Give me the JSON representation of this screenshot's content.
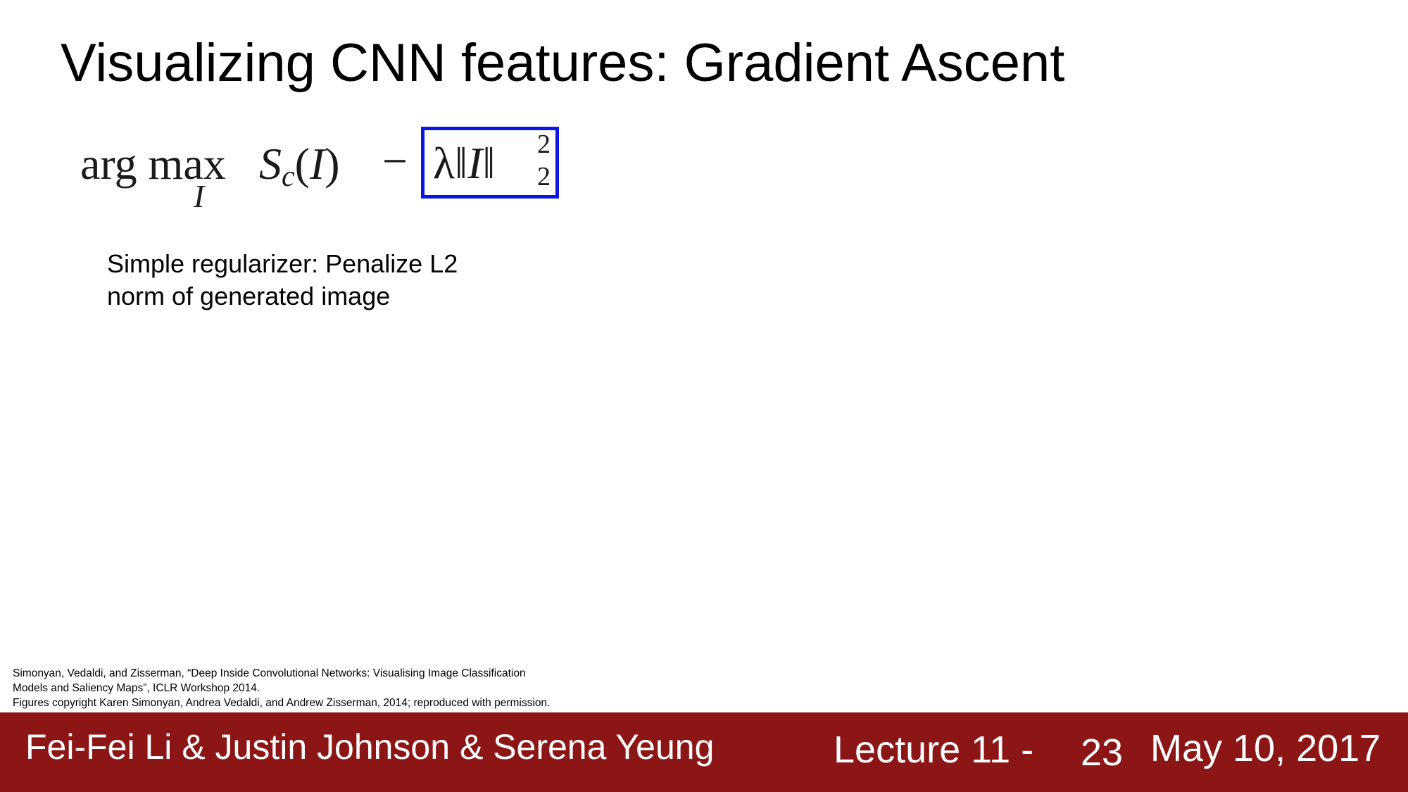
{
  "slide": {
    "title": "Visualizing CNN features: Gradient Ascent",
    "formula": {
      "operator": "arg max",
      "operator_subscript": "I",
      "score_symbol": "S",
      "score_subscript": "c",
      "score_argument": "I",
      "minus": "−",
      "regularizer": {
        "lambda": "λ",
        "norm_open": "‖",
        "variable": "I",
        "norm_close": "‖",
        "superscript": "2",
        "subscript": "2"
      },
      "highlight_color": "#0b16e0"
    },
    "note_lines": [
      "Simple regularizer: Penalize L2",
      "norm of generated image"
    ],
    "citation_lines": [
      "Simonyan, Vedaldi, and Zisserman, “Deep Inside Convolutional Networks: Visualising Image Classification",
      "Models and Saliency Maps”, ICLR Workshop 2014.",
      "Figures copyright Karen Simonyan, Andrea Vedaldi, and Andrew Zisserman, 2014; reproduced with permission."
    ]
  },
  "footer": {
    "authors": "Fei-Fei Li & Justin Johnson & Serena Yeung",
    "lecture": "Lecture 11 -",
    "page_number": "23",
    "date": "May 10, 2017",
    "background_color": "#8c1515",
    "text_color": "#ffffff"
  }
}
